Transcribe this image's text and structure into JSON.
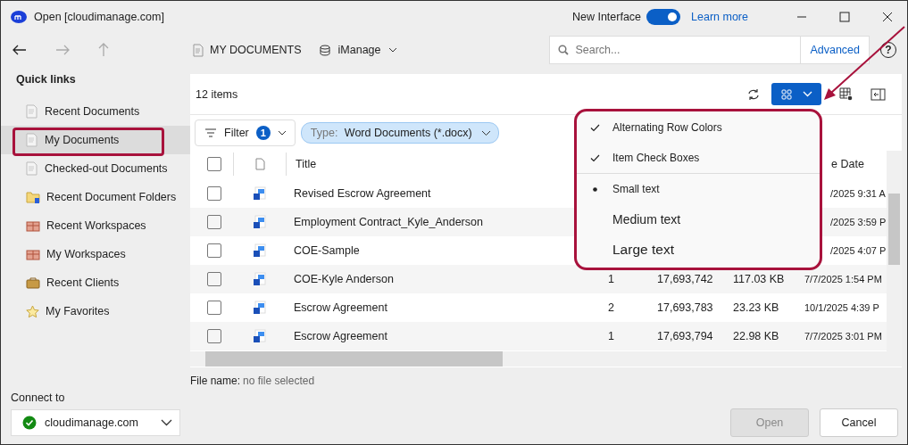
{
  "window": {
    "title": "Open [cloudimanage.com]",
    "new_interface": {
      "label": "New Interface",
      "on": true
    },
    "learn_more": "Learn more"
  },
  "nav": {
    "breadcrumb": "MY DOCUMENTS",
    "repository": "iManage",
    "search": {
      "placeholder": "Search..."
    },
    "advanced": "Advanced",
    "help": "?"
  },
  "sidebar": {
    "title": "Quick links",
    "items": [
      {
        "label": "Recent Documents",
        "kind": "doc",
        "selected": false
      },
      {
        "label": "My Documents",
        "kind": "doc",
        "selected": true
      },
      {
        "label": "Checked-out Documents",
        "kind": "doc",
        "selected": false
      },
      {
        "label": "Recent Document Folders",
        "kind": "folder",
        "selected": false
      },
      {
        "label": "Recent Workspaces",
        "kind": "workspace",
        "selected": false
      },
      {
        "label": "My Workspaces",
        "kind": "workspace",
        "selected": false
      },
      {
        "label": "Recent Clients",
        "kind": "client",
        "selected": false
      },
      {
        "label": "My Favorites",
        "kind": "star",
        "selected": false
      }
    ]
  },
  "list": {
    "count": "12 items",
    "filter": {
      "label": "Filter",
      "count": "1"
    },
    "type_chip": {
      "key": "Type:",
      "value": "Word Documents (*.docx)"
    },
    "select_all": {
      "checked": false
    },
    "columns": {
      "title": "Title",
      "column_8": "e Date"
    },
    "rows": [
      {
        "title": "Revised Escrow Agreement",
        "checked": false,
        "date": "/2025 9:31 A"
      },
      {
        "title": "Employment Contract_Kyle_Anderson",
        "checked": false,
        "date": "/2025 3:59 P"
      },
      {
        "title": "COE-Sample",
        "checked": false,
        "date": "/2025 4:07 P"
      },
      {
        "title": "COE-Kyle Anderson",
        "checked": false,
        "version": "1",
        "number": "17,693,742",
        "size": "117.03 KB",
        "date": "7/7/2025 1:54 PM"
      },
      {
        "title": "Escrow Agreement",
        "checked": false,
        "version": "2",
        "number": "17,693,783",
        "size": "23.23 KB",
        "date": "10/1/2025 4:39 P"
      },
      {
        "title": "Escrow Agreement",
        "checked": false,
        "version": "1",
        "number": "17,693,794",
        "size": "22.98 KB",
        "date": "7/7/2025 3:01 PM"
      }
    ]
  },
  "view_menu": {
    "items": [
      {
        "label": "Alternating Row Colors",
        "kind": "check",
        "checked": true
      },
      {
        "label": "Item Check Boxes",
        "kind": "check",
        "checked": true
      },
      {
        "label": "Small text",
        "kind": "small-text",
        "selected": true
      },
      {
        "label": "Medium text",
        "kind": "medium-text",
        "selected": false
      },
      {
        "label": "Large text",
        "kind": "large-text",
        "selected": false
      }
    ]
  },
  "file_name": {
    "label": "File name:",
    "value": "no file selected"
  },
  "connect": {
    "label": "Connect to",
    "server": "cloudimanage.com",
    "connected": true
  },
  "buttons": [
    {
      "label": "Open",
      "disabled": true
    },
    {
      "label": "Cancel",
      "disabled": false
    }
  ]
}
